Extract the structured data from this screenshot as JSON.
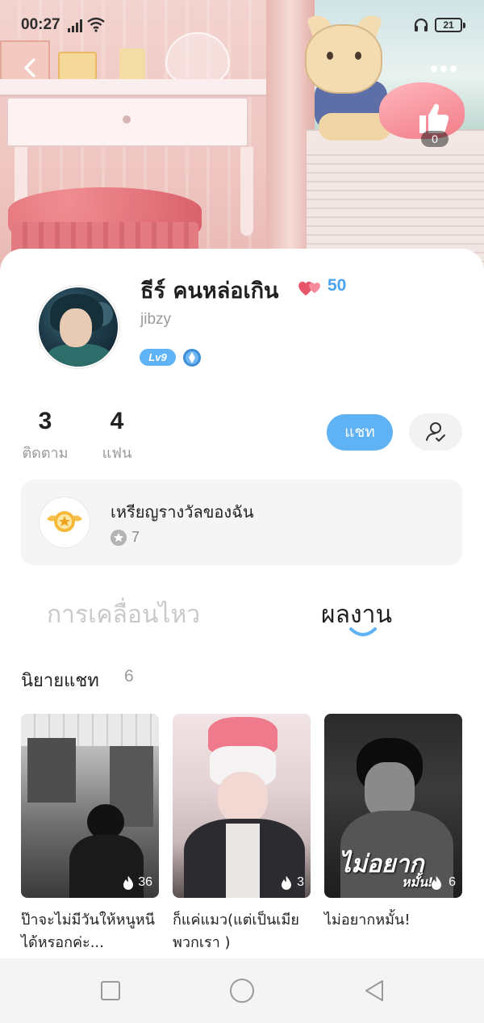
{
  "status_bar": {
    "time": "00:27",
    "battery": "21"
  },
  "header": {
    "like_count": "0"
  },
  "profile": {
    "name": "ธีร์ คนหล่อเกิน",
    "hearts_count": "50",
    "user_id": "jibzy",
    "level": "Lv9"
  },
  "stats": {
    "following_count": "3",
    "following_label": "ติดตาม",
    "fans_count": "4",
    "fans_label": "แฟน"
  },
  "actions": {
    "chat_label": "แชท"
  },
  "medals": {
    "title": "เหรียญรางวัลของฉัน",
    "count": "7"
  },
  "tabs": [
    {
      "label": "การเคลื่อนไหว",
      "active": false
    },
    {
      "label": "ผลงาน",
      "active": true
    }
  ],
  "section": {
    "title": "นิยายแชท",
    "count": "6"
  },
  "novels": [
    {
      "title": "ป๊าจะไม่มีวันให้หนูหนีได้หรอกค่ะ...",
      "views": "36"
    },
    {
      "title": "ก็แค่แมว(แต่เป็นเมียพวกเรา )",
      "views": "3"
    },
    {
      "title": "ไม่อยากหมั้น!",
      "views": "6",
      "cover_text": "ไม่อยาก",
      "cover_subtext": "หมั้น!"
    }
  ],
  "colors": {
    "accent": "#5fb3f4",
    "hearts": "#4aa3f0",
    "card_bg": "#f5f5f5"
  }
}
